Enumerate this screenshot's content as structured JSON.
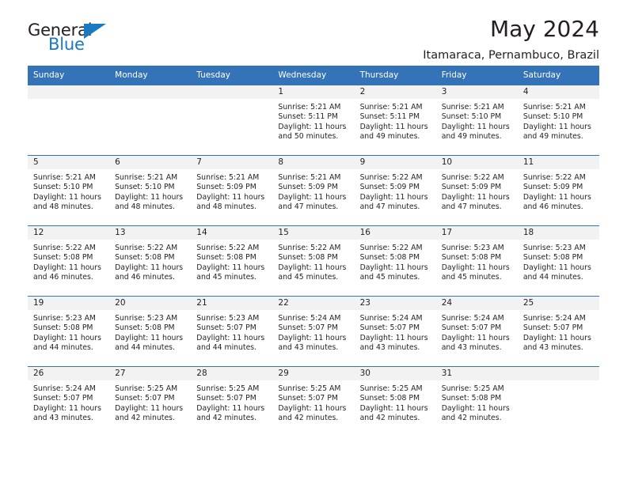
{
  "brand": {
    "name_part1": "General",
    "name_part2": "Blue",
    "triangle_color": "#1b79c3",
    "text_color": "#231f20"
  },
  "header": {
    "title": "May 2024",
    "subtitle": "Itamaraca, Pernambuco, Brazil"
  },
  "theme": {
    "header_blue": "#3573b9",
    "day_number_band": "#f2f2f2",
    "text": "#221f1f"
  },
  "calendar": {
    "day_headers": [
      "Sunday",
      "Monday",
      "Tuesday",
      "Wednesday",
      "Thursday",
      "Friday",
      "Saturday"
    ],
    "weeks": [
      [
        {
          "day": "",
          "sunrise": "",
          "sunset": "",
          "daylight_line1": "",
          "daylight_line2": ""
        },
        {
          "day": "",
          "sunrise": "",
          "sunset": "",
          "daylight_line1": "",
          "daylight_line2": ""
        },
        {
          "day": "",
          "sunrise": "",
          "sunset": "",
          "daylight_line1": "",
          "daylight_line2": ""
        },
        {
          "day": "1",
          "sunrise": "Sunrise: 5:21 AM",
          "sunset": "Sunset: 5:11 PM",
          "daylight_line1": "Daylight: 11 hours",
          "daylight_line2": "and 50 minutes."
        },
        {
          "day": "2",
          "sunrise": "Sunrise: 5:21 AM",
          "sunset": "Sunset: 5:11 PM",
          "daylight_line1": "Daylight: 11 hours",
          "daylight_line2": "and 49 minutes."
        },
        {
          "day": "3",
          "sunrise": "Sunrise: 5:21 AM",
          "sunset": "Sunset: 5:10 PM",
          "daylight_line1": "Daylight: 11 hours",
          "daylight_line2": "and 49 minutes."
        },
        {
          "day": "4",
          "sunrise": "Sunrise: 5:21 AM",
          "sunset": "Sunset: 5:10 PM",
          "daylight_line1": "Daylight: 11 hours",
          "daylight_line2": "and 49 minutes."
        }
      ],
      [
        {
          "day": "5",
          "sunrise": "Sunrise: 5:21 AM",
          "sunset": "Sunset: 5:10 PM",
          "daylight_line1": "Daylight: 11 hours",
          "daylight_line2": "and 48 minutes."
        },
        {
          "day": "6",
          "sunrise": "Sunrise: 5:21 AM",
          "sunset": "Sunset: 5:10 PM",
          "daylight_line1": "Daylight: 11 hours",
          "daylight_line2": "and 48 minutes."
        },
        {
          "day": "7",
          "sunrise": "Sunrise: 5:21 AM",
          "sunset": "Sunset: 5:09 PM",
          "daylight_line1": "Daylight: 11 hours",
          "daylight_line2": "and 48 minutes."
        },
        {
          "day": "8",
          "sunrise": "Sunrise: 5:21 AM",
          "sunset": "Sunset: 5:09 PM",
          "daylight_line1": "Daylight: 11 hours",
          "daylight_line2": "and 47 minutes."
        },
        {
          "day": "9",
          "sunrise": "Sunrise: 5:22 AM",
          "sunset": "Sunset: 5:09 PM",
          "daylight_line1": "Daylight: 11 hours",
          "daylight_line2": "and 47 minutes."
        },
        {
          "day": "10",
          "sunrise": "Sunrise: 5:22 AM",
          "sunset": "Sunset: 5:09 PM",
          "daylight_line1": "Daylight: 11 hours",
          "daylight_line2": "and 47 minutes."
        },
        {
          "day": "11",
          "sunrise": "Sunrise: 5:22 AM",
          "sunset": "Sunset: 5:09 PM",
          "daylight_line1": "Daylight: 11 hours",
          "daylight_line2": "and 46 minutes."
        }
      ],
      [
        {
          "day": "12",
          "sunrise": "Sunrise: 5:22 AM",
          "sunset": "Sunset: 5:08 PM",
          "daylight_line1": "Daylight: 11 hours",
          "daylight_line2": "and 46 minutes."
        },
        {
          "day": "13",
          "sunrise": "Sunrise: 5:22 AM",
          "sunset": "Sunset: 5:08 PM",
          "daylight_line1": "Daylight: 11 hours",
          "daylight_line2": "and 46 minutes."
        },
        {
          "day": "14",
          "sunrise": "Sunrise: 5:22 AM",
          "sunset": "Sunset: 5:08 PM",
          "daylight_line1": "Daylight: 11 hours",
          "daylight_line2": "and 45 minutes."
        },
        {
          "day": "15",
          "sunrise": "Sunrise: 5:22 AM",
          "sunset": "Sunset: 5:08 PM",
          "daylight_line1": "Daylight: 11 hours",
          "daylight_line2": "and 45 minutes."
        },
        {
          "day": "16",
          "sunrise": "Sunrise: 5:22 AM",
          "sunset": "Sunset: 5:08 PM",
          "daylight_line1": "Daylight: 11 hours",
          "daylight_line2": "and 45 minutes."
        },
        {
          "day": "17",
          "sunrise": "Sunrise: 5:23 AM",
          "sunset": "Sunset: 5:08 PM",
          "daylight_line1": "Daylight: 11 hours",
          "daylight_line2": "and 45 minutes."
        },
        {
          "day": "18",
          "sunrise": "Sunrise: 5:23 AM",
          "sunset": "Sunset: 5:08 PM",
          "daylight_line1": "Daylight: 11 hours",
          "daylight_line2": "and 44 minutes."
        }
      ],
      [
        {
          "day": "19",
          "sunrise": "Sunrise: 5:23 AM",
          "sunset": "Sunset: 5:08 PM",
          "daylight_line1": "Daylight: 11 hours",
          "daylight_line2": "and 44 minutes."
        },
        {
          "day": "20",
          "sunrise": "Sunrise: 5:23 AM",
          "sunset": "Sunset: 5:08 PM",
          "daylight_line1": "Daylight: 11 hours",
          "daylight_line2": "and 44 minutes."
        },
        {
          "day": "21",
          "sunrise": "Sunrise: 5:23 AM",
          "sunset": "Sunset: 5:07 PM",
          "daylight_line1": "Daylight: 11 hours",
          "daylight_line2": "and 44 minutes."
        },
        {
          "day": "22",
          "sunrise": "Sunrise: 5:24 AM",
          "sunset": "Sunset: 5:07 PM",
          "daylight_line1": "Daylight: 11 hours",
          "daylight_line2": "and 43 minutes."
        },
        {
          "day": "23",
          "sunrise": "Sunrise: 5:24 AM",
          "sunset": "Sunset: 5:07 PM",
          "daylight_line1": "Daylight: 11 hours",
          "daylight_line2": "and 43 minutes."
        },
        {
          "day": "24",
          "sunrise": "Sunrise: 5:24 AM",
          "sunset": "Sunset: 5:07 PM",
          "daylight_line1": "Daylight: 11 hours",
          "daylight_line2": "and 43 minutes."
        },
        {
          "day": "25",
          "sunrise": "Sunrise: 5:24 AM",
          "sunset": "Sunset: 5:07 PM",
          "daylight_line1": "Daylight: 11 hours",
          "daylight_line2": "and 43 minutes."
        }
      ],
      [
        {
          "day": "26",
          "sunrise": "Sunrise: 5:24 AM",
          "sunset": "Sunset: 5:07 PM",
          "daylight_line1": "Daylight: 11 hours",
          "daylight_line2": "and 43 minutes."
        },
        {
          "day": "27",
          "sunrise": "Sunrise: 5:25 AM",
          "sunset": "Sunset: 5:07 PM",
          "daylight_line1": "Daylight: 11 hours",
          "daylight_line2": "and 42 minutes."
        },
        {
          "day": "28",
          "sunrise": "Sunrise: 5:25 AM",
          "sunset": "Sunset: 5:07 PM",
          "daylight_line1": "Daylight: 11 hours",
          "daylight_line2": "and 42 minutes."
        },
        {
          "day": "29",
          "sunrise": "Sunrise: 5:25 AM",
          "sunset": "Sunset: 5:07 PM",
          "daylight_line1": "Daylight: 11 hours",
          "daylight_line2": "and 42 minutes."
        },
        {
          "day": "30",
          "sunrise": "Sunrise: 5:25 AM",
          "sunset": "Sunset: 5:08 PM",
          "daylight_line1": "Daylight: 11 hours",
          "daylight_line2": "and 42 minutes."
        },
        {
          "day": "31",
          "sunrise": "Sunrise: 5:25 AM",
          "sunset": "Sunset: 5:08 PM",
          "daylight_line1": "Daylight: 11 hours",
          "daylight_line2": "and 42 minutes."
        },
        {
          "day": "",
          "sunrise": "",
          "sunset": "",
          "daylight_line1": "",
          "daylight_line2": ""
        }
      ]
    ]
  }
}
